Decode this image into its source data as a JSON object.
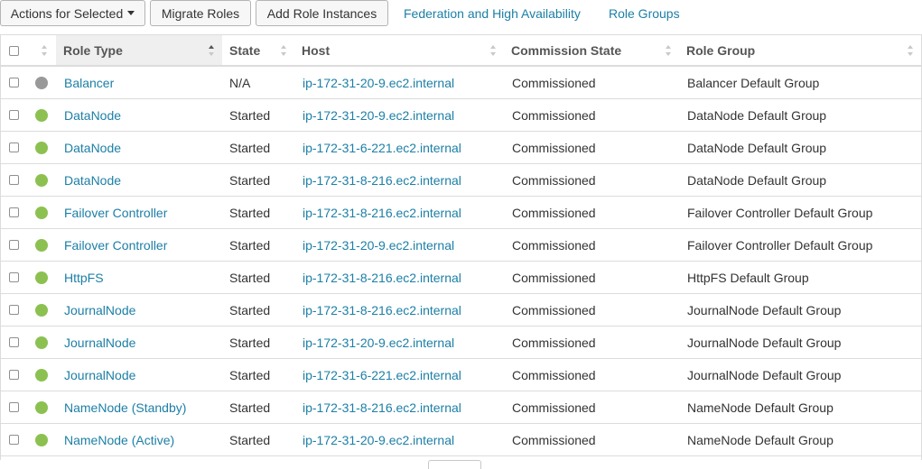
{
  "toolbar": {
    "actions_label": "Actions for Selected",
    "migrate_label": "Migrate Roles",
    "add_label": "Add Role Instances",
    "federation_link": "Federation and High Availability",
    "role_groups_link": "Role Groups"
  },
  "table": {
    "columns": {
      "role_type": "Role Type",
      "state": "State",
      "host": "Host",
      "commission_state": "Commission State",
      "role_group": "Role Group"
    },
    "sorted_column": "Role Type",
    "status_colors": {
      "started": "#8cc152",
      "na": "#999999"
    },
    "rows": [
      {
        "role_type": "Balancer",
        "state": "N/A",
        "host": "ip-172-31-20-9.ec2.internal",
        "commission_state": "Commissioned",
        "role_group": "Balancer Default Group",
        "status": "na"
      },
      {
        "role_type": "DataNode",
        "state": "Started",
        "host": "ip-172-31-20-9.ec2.internal",
        "commission_state": "Commissioned",
        "role_group": "DataNode Default Group",
        "status": "started"
      },
      {
        "role_type": "DataNode",
        "state": "Started",
        "host": "ip-172-31-6-221.ec2.internal",
        "commission_state": "Commissioned",
        "role_group": "DataNode Default Group",
        "status": "started"
      },
      {
        "role_type": "DataNode",
        "state": "Started",
        "host": "ip-172-31-8-216.ec2.internal",
        "commission_state": "Commissioned",
        "role_group": "DataNode Default Group",
        "status": "started"
      },
      {
        "role_type": "Failover Controller",
        "state": "Started",
        "host": "ip-172-31-8-216.ec2.internal",
        "commission_state": "Commissioned",
        "role_group": "Failover Controller Default Group",
        "status": "started"
      },
      {
        "role_type": "Failover Controller",
        "state": "Started",
        "host": "ip-172-31-20-9.ec2.internal",
        "commission_state": "Commissioned",
        "role_group": "Failover Controller Default Group",
        "status": "started"
      },
      {
        "role_type": "HttpFS",
        "state": "Started",
        "host": "ip-172-31-8-216.ec2.internal",
        "commission_state": "Commissioned",
        "role_group": "HttpFS Default Group",
        "status": "started"
      },
      {
        "role_type": "JournalNode",
        "state": "Started",
        "host": "ip-172-31-8-216.ec2.internal",
        "commission_state": "Commissioned",
        "role_group": "JournalNode Default Group",
        "status": "started"
      },
      {
        "role_type": "JournalNode",
        "state": "Started",
        "host": "ip-172-31-20-9.ec2.internal",
        "commission_state": "Commissioned",
        "role_group": "JournalNode Default Group",
        "status": "started"
      },
      {
        "role_type": "JournalNode",
        "state": "Started",
        "host": "ip-172-31-6-221.ec2.internal",
        "commission_state": "Commissioned",
        "role_group": "JournalNode Default Group",
        "status": "started"
      },
      {
        "role_type": "NameNode (Standby)",
        "state": "Started",
        "host": "ip-172-31-8-216.ec2.internal",
        "commission_state": "Commissioned",
        "role_group": "NameNode Default Group",
        "status": "started"
      },
      {
        "role_type": "NameNode (Active)",
        "state": "Started",
        "host": "ip-172-31-20-9.ec2.internal",
        "commission_state": "Commissioned",
        "role_group": "NameNode Default Group",
        "status": "started"
      }
    ]
  }
}
